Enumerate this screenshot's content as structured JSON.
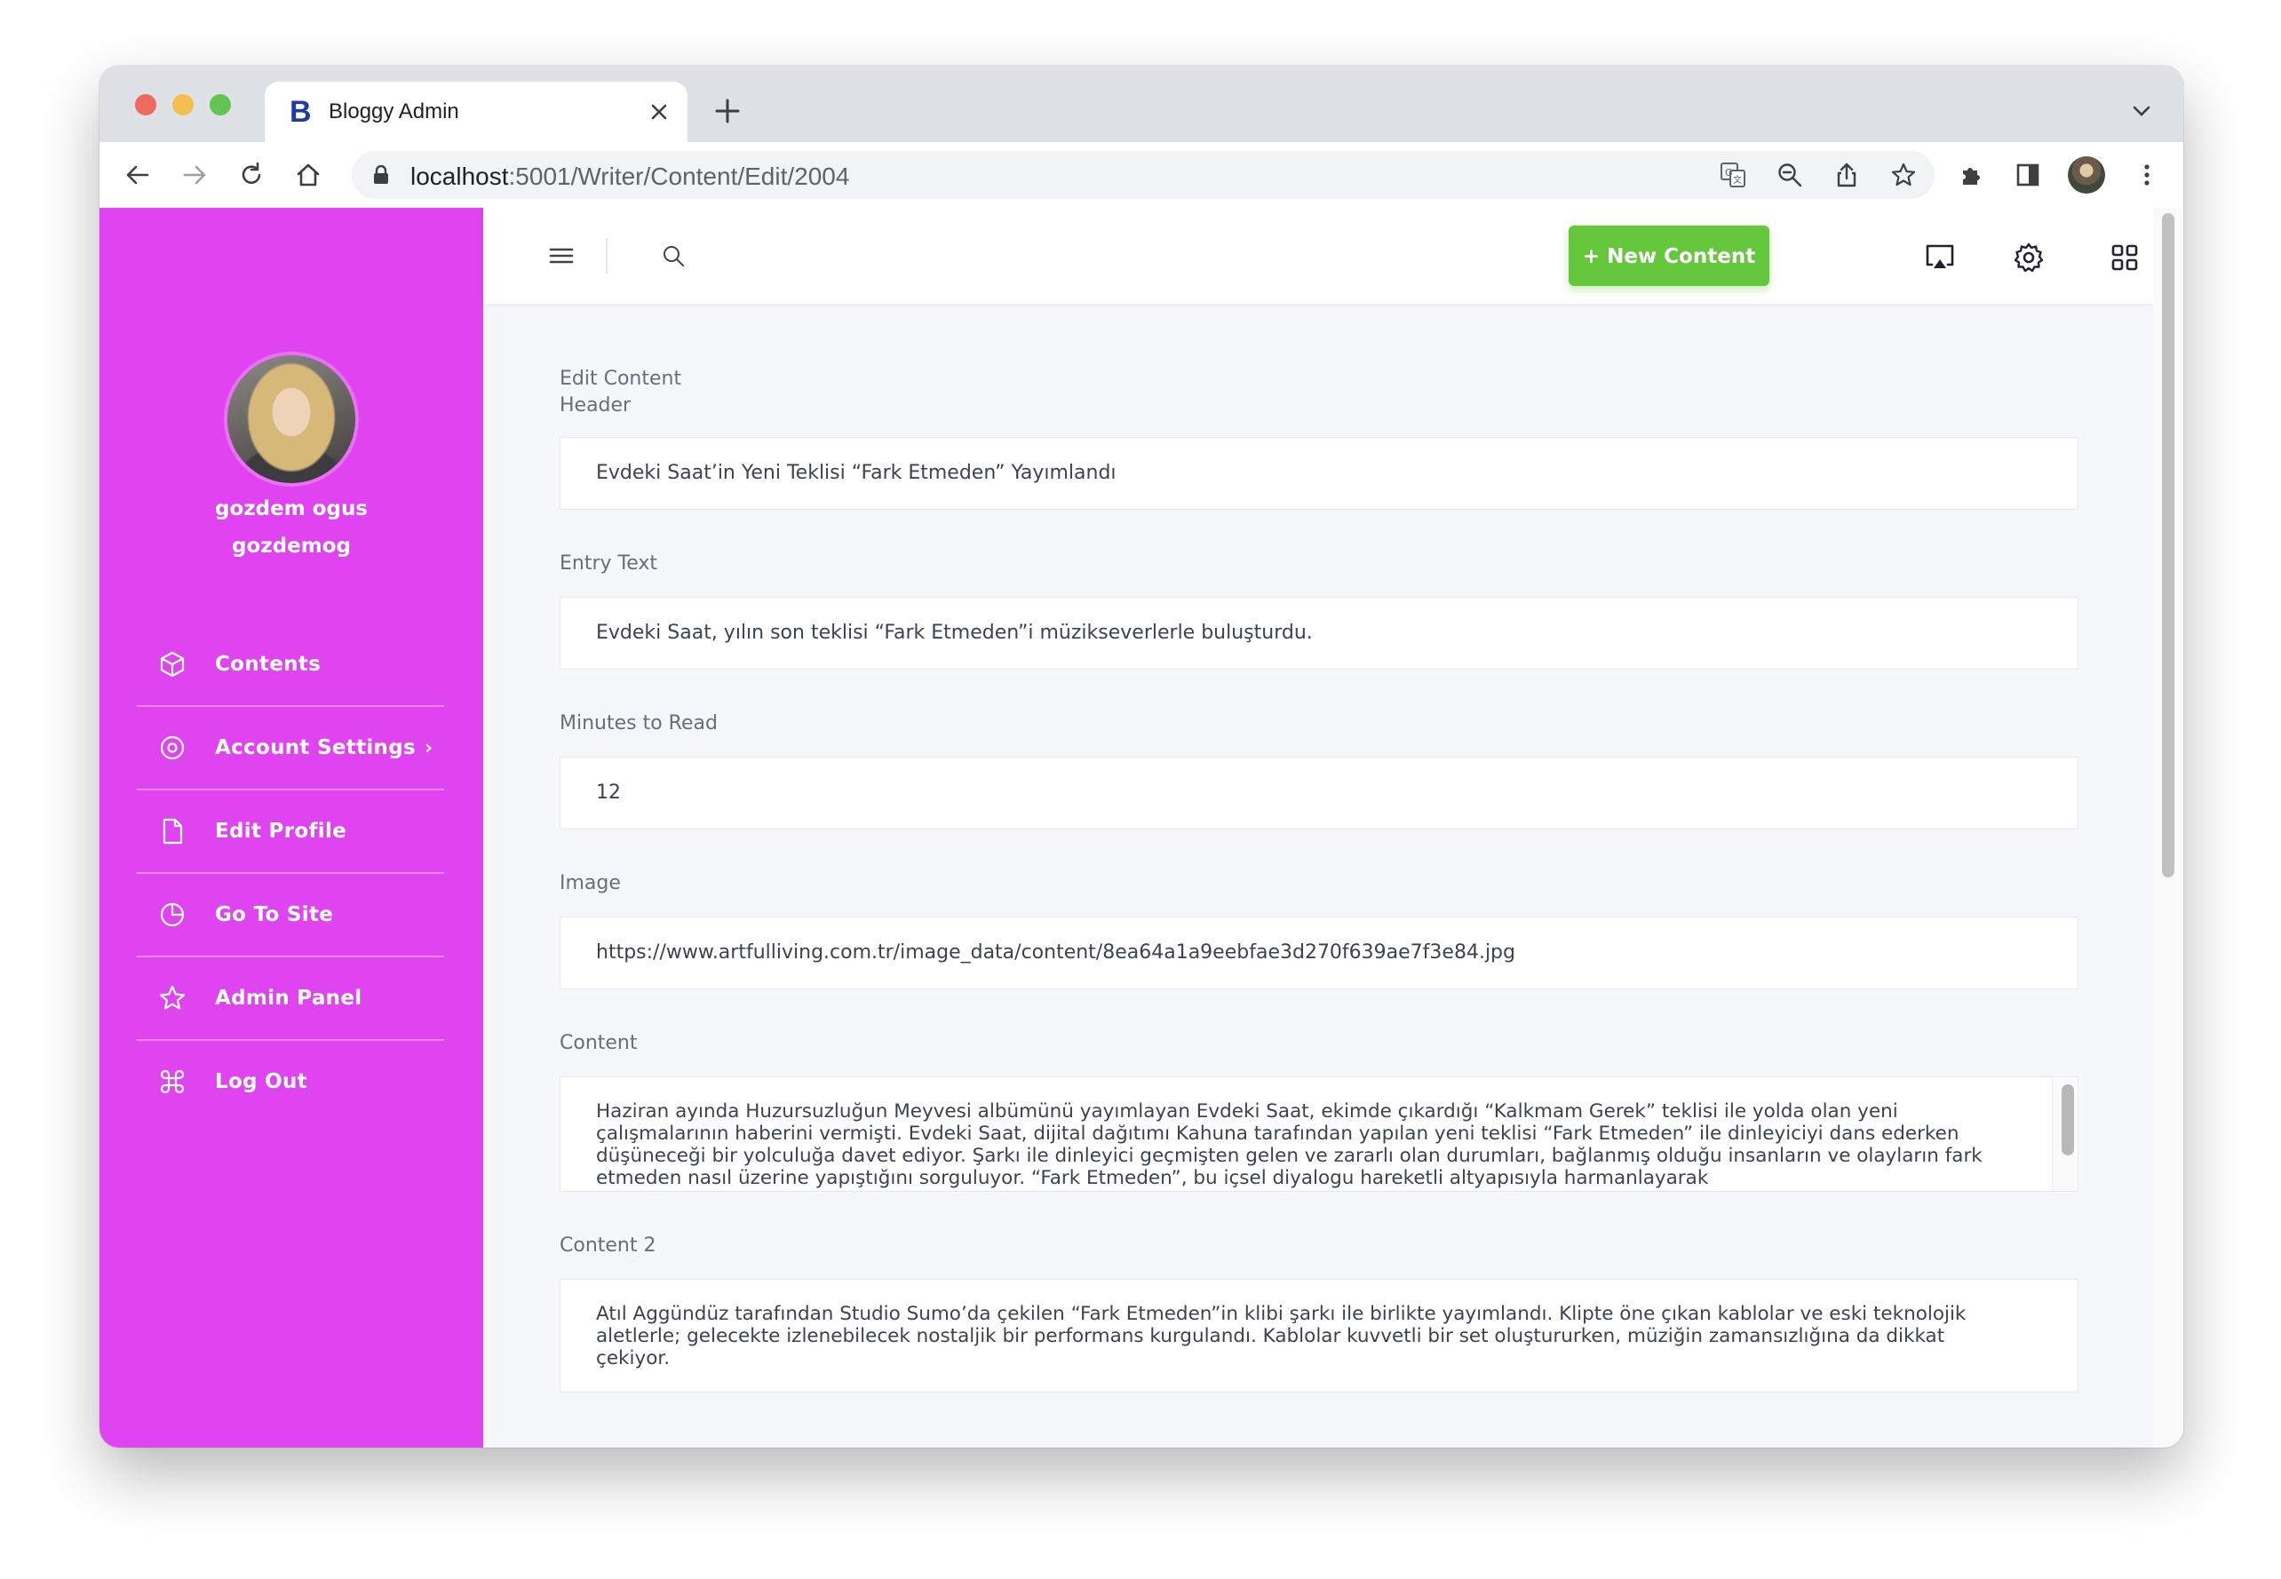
{
  "browser": {
    "tab_title": "Bloggy Admin",
    "tab_favicon": "B",
    "url_host": "localhost",
    "url_path": ":5001/Writer/Content/Edit/2004"
  },
  "sidebar": {
    "user_name": "gozdem ogus",
    "user_handle": "gozdemog",
    "items": [
      {
        "label": "Contents",
        "icon": "cube-icon"
      },
      {
        "label": "Account Settings",
        "icon": "target-icon",
        "chevron": "›"
      },
      {
        "label": "Edit Profile",
        "icon": "file-icon"
      },
      {
        "label": "Go To Site",
        "icon": "pie-chart-icon"
      },
      {
        "label": "Admin Panel",
        "icon": "star-icon"
      },
      {
        "label": "Log Out",
        "icon": "command-icon"
      }
    ]
  },
  "topbar": {
    "new_content_label": "+ New Content"
  },
  "form": {
    "title": "Edit Content",
    "header_label": "Header",
    "header_value": "Evdeki Saat’in Yeni Teklisi “Fark Etmeden” Yayımlandı",
    "entry_label": "Entry Text",
    "entry_value": "Evdeki Saat, yılın son teklisi “Fark Etmeden”i müzikseverlerle buluşturdu.",
    "minutes_label": "Minutes to Read",
    "minutes_value": "12",
    "image_label": "Image",
    "image_value": "https://www.artfulliving.com.tr/image_data/content/8ea64a1a9eebfae3d270f639ae7f3e84.jpg",
    "content_label": "Content",
    "content_value": "Haziran ayında Huzursuzluğun Meyvesi albümünü yayımlayan Evdeki Saat, ekimde çıkardığı “Kalkmam Gerek” teklisi ile yolda olan yeni çalışmalarının haberini vermişti. Evdeki Saat, dijital dağıtımı Kahuna tarafından yapılan yeni teklisi “Fark Etmeden” ile dinleyiciyi dans ederken düşüneceği bir yolculuğa davet ediyor. Şarkı ile dinleyici geçmişten gelen ve zararlı olan durumları, bağlanmış olduğu insanların ve olayların fark etmeden nasıl üzerine yapıştığını sorguluyor. “Fark Etmeden”, bu içsel diyalogu hareketli altyapısıyla harmanlayarak",
    "content2_label": "Content 2",
    "content2_value": "Atıl Aggündüz tarafından Studio Sumo’da çekilen “Fark Etmeden”in klibi şarkı ile birlikte yayımlandı. Klipte öne çıkan kablolar ve eski teknolojik aletlerle; gelecekte izlenebilecek nostaljik bir performans kurgulandı. Kablolar kuvvetli bir set oluştururken, müziğin zamansızlığına da dikkat çekiyor."
  },
  "colors": {
    "sidebar": "#df44f0",
    "accent_button": "#65c73c",
    "page_bg": "#f5f7fb"
  }
}
